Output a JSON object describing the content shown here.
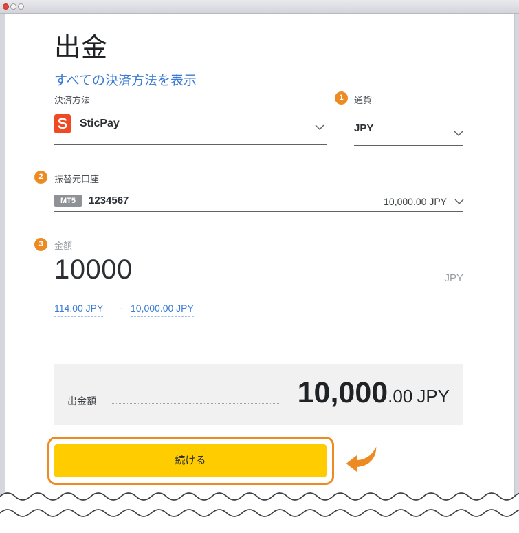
{
  "page": {
    "title": "出金",
    "show_all_link": "すべての決済方法を表示"
  },
  "method": {
    "label": "決済方法",
    "logo_letter": "S",
    "value": "SticPay",
    "logo_color": "#f04a24"
  },
  "currency": {
    "badge": "1",
    "label": "通貨",
    "value": "JPY"
  },
  "account": {
    "badge": "2",
    "label": "振替元口座",
    "platform_tag": "MT5",
    "number": "1234567",
    "balance": "10,000.00 JPY"
  },
  "amount": {
    "badge": "3",
    "label": "金額",
    "value": "10000",
    "unit": "JPY",
    "min": "114.00 JPY",
    "separator": "-",
    "max": "10,000.00 JPY"
  },
  "summary": {
    "label": "出金額",
    "amount_int": "10,000",
    "amount_frac": ".00",
    "currency": "JPY"
  },
  "actions": {
    "continue_label": "続ける"
  },
  "colors": {
    "accent_link": "#3a7bd5",
    "button": "#ffcc00",
    "highlight": "#ed8b22",
    "summary_bg": "#f1f1f2"
  }
}
